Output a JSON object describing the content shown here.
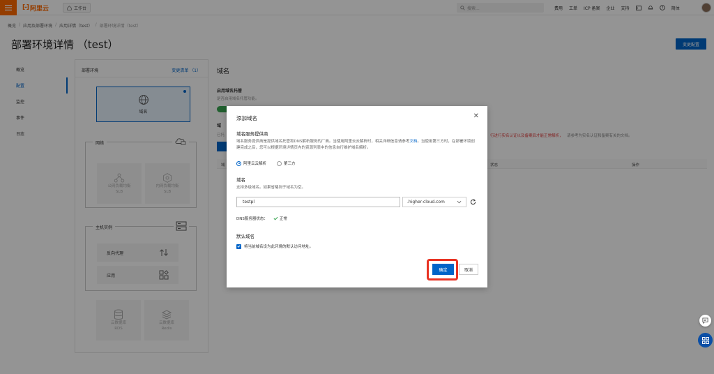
{
  "topbar": {
    "logo_mark": "[-]",
    "logo_text": "阿里云",
    "workbench": "工作台",
    "search_placeholder": "搜索...",
    "nav": [
      "费用",
      "工单",
      "ICP 备案",
      "企业",
      "支持"
    ],
    "lang": "简体"
  },
  "breadcrumb": {
    "items": [
      "概览",
      "应用及部署环境",
      "应用详情（test）",
      "部署环境详情（test）"
    ]
  },
  "page": {
    "title": "部署环境详情 （test）",
    "action_button": "变更配置"
  },
  "sidenav": {
    "items": [
      "概览",
      "配置",
      "监控",
      "事件",
      "日志"
    ],
    "active_index": 1
  },
  "env_panel": {
    "title": "部署环境",
    "change_link": "变更清单 （1）",
    "domain_label": "域名",
    "network_group": "网络",
    "public_slb": "公网负载均衡",
    "private_slb": "内网负载均衡",
    "slb": "SLB",
    "host_group": "主机实例",
    "reverse_proxy": "反向代理",
    "app": "应用",
    "cloud_db": "云数据库",
    "rds": "RDS",
    "redis": "Redis"
  },
  "background": {
    "section_title": "域名",
    "hosting_title": "启用域名托管",
    "hosting_desc": "是否启用域名托管功能。",
    "domain_sec_title": "域",
    "domain_sec_desc": "已托",
    "red_notice": "行进行实名认证以及备案后才能正常解析，",
    "tail_notice": "请参考为实名认证和备案有关的文档。",
    "table_col_status": "状态",
    "table_col_action": "操作",
    "table_col_first": "域"
  },
  "modal": {
    "title": "添加域名",
    "provider_heading": "域名服务提供商",
    "provider_desc_1": "域名服务提供商是提供域名托管和DNS解析服务的厂商。当使用阿里云云解析时，相关详细信息请参考",
    "provider_desc_link": "文档",
    "provider_desc_2": "。当使用第三方时，在部署环境创建完成之后，您可以根据环境详情页内的资源列表中的信息自行维护域名解析。",
    "radio_aliyun": "阿里云云解析",
    "radio_third": "第三方",
    "domain_heading": "域名",
    "domain_desc": "支持多级域名。如果省略则子域名为空。",
    "domain_input_value": "testpl",
    "domain_suffix": ".higher-cloud.com",
    "dns_label": "DNS服务器状态：",
    "dns_status": "正常",
    "default_heading": "默认域名",
    "default_checkbox": "将当前域名设为此环境的默认访问地址。",
    "ok_button": "确定",
    "cancel_button": "取消"
  },
  "colors": {
    "brand": "#ff6a00",
    "primary": "#0064c8",
    "highlight": "#e83323",
    "success": "#3aa552"
  }
}
